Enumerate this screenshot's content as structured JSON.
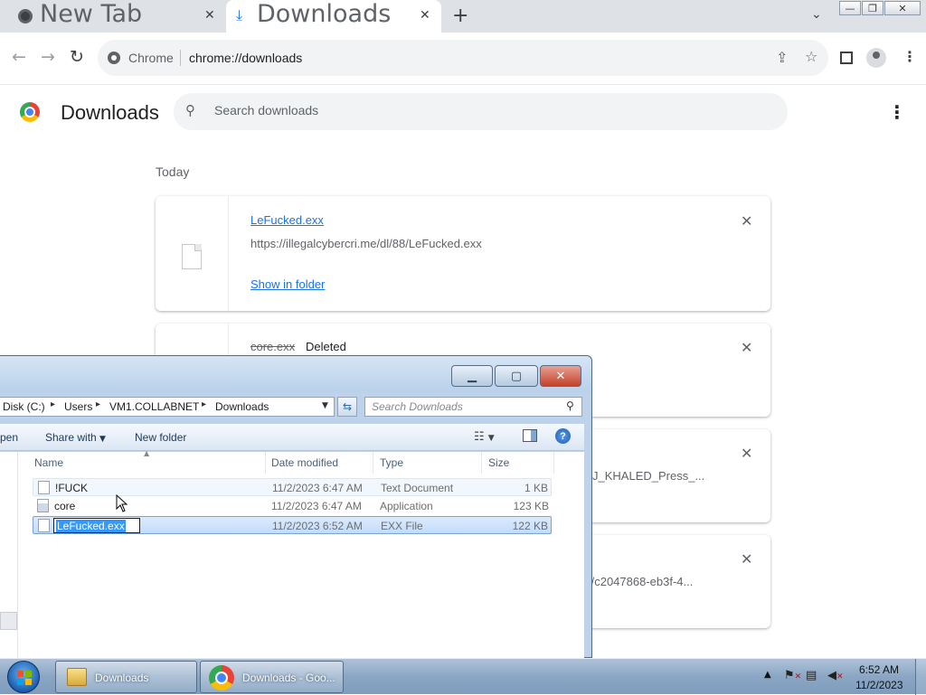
{
  "browser": {
    "tabs": [
      {
        "title": "New Tab",
        "active": false
      },
      {
        "title": "Downloads",
        "active": true
      }
    ],
    "new_tab_symbol": "+",
    "tab_list_symbol": "⌄",
    "omnibox": {
      "site_label": "Chrome",
      "url": "chrome://downloads"
    },
    "window_controls": {
      "minimize": "—",
      "restore": "❐",
      "close": "✕"
    }
  },
  "downloads_page": {
    "title": "Downloads",
    "search_placeholder": "Search downloads",
    "section_label": "Today",
    "items": [
      {
        "filename": "LeFucked.exx",
        "url": "https://illegalcybercri.me/dl/88/LeFucked.exx",
        "action": "Show in folder"
      },
      {
        "filename": "core.exx",
        "status": "Deleted"
      },
      {
        "url_fragment": "J_KHALED_Press_..."
      },
      {
        "url_fragment": "f/c2047868-eb3f-4..."
      }
    ]
  },
  "explorer": {
    "breadcrumb": [
      "Disk (C:)",
      "Users",
      "VM1.COLLABNET",
      "Downloads"
    ],
    "search_placeholder": "Search Downloads",
    "commands": {
      "open": "pen",
      "share_with": "Share with",
      "new_folder": "New folder"
    },
    "columns": [
      "Name",
      "Date modified",
      "Type",
      "Size"
    ],
    "files": [
      {
        "name": "!FUCK",
        "date": "11/2/2023 6:47 AM",
        "type": "Text Document",
        "size": "1 KB",
        "icon": "text-file-icon"
      },
      {
        "name": "core",
        "date": "11/2/2023 6:47 AM",
        "type": "Application",
        "size": "123 KB",
        "icon": "application-icon"
      },
      {
        "name": "LeFucked.exx",
        "date": "11/2/2023 6:52 AM",
        "type": "EXX File",
        "size": "122 KB",
        "icon": "generic-file-icon",
        "renaming": true
      }
    ]
  },
  "taskbar": {
    "buttons": [
      {
        "label": "Downloads",
        "icon": "folder-icon"
      },
      {
        "label": "Downloads - Goo...",
        "icon": "chrome-icon"
      }
    ],
    "clock": {
      "time": "6:52 AM",
      "date": "11/2/2023"
    }
  },
  "colors": {
    "chrome_tabstrip": "#dee1e6",
    "link_blue": "#1a73e8",
    "taskbar": "#8ba6c4",
    "selection": "#3399ff"
  }
}
